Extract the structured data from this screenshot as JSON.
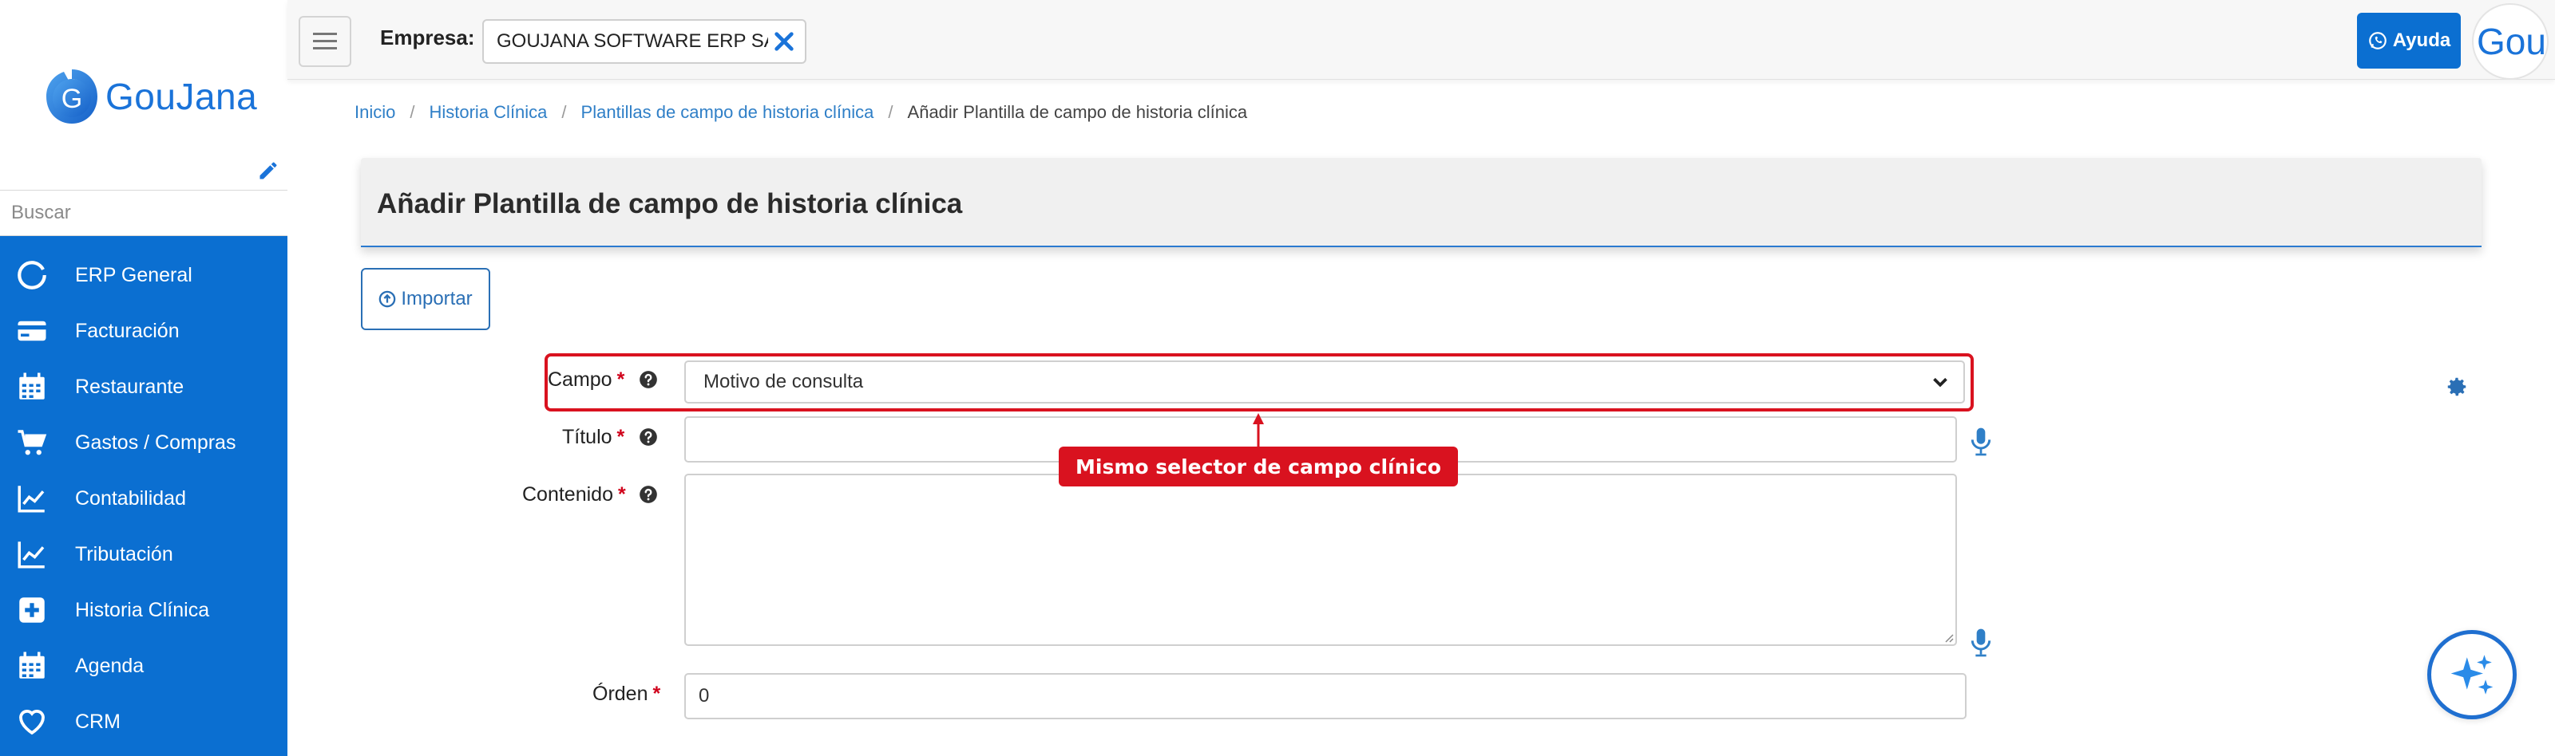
{
  "sidebar": {
    "logo_text": "GouJana",
    "search_placeholder": "Buscar",
    "items": [
      {
        "label": "ERP General",
        "icon": "refresh-circle-icon"
      },
      {
        "label": "Facturación",
        "icon": "credit-card-icon"
      },
      {
        "label": "Restaurante",
        "icon": "calendar-icon"
      },
      {
        "label": "Gastos / Compras",
        "icon": "cart-icon"
      },
      {
        "label": "Contabilidad",
        "icon": "chart-line-icon"
      },
      {
        "label": "Tributación",
        "icon": "chart-line-icon"
      },
      {
        "label": "Historia Clínica",
        "icon": "plus-square-icon"
      },
      {
        "label": "Agenda",
        "icon": "calendar-icon"
      },
      {
        "label": "CRM",
        "icon": "heart-icon"
      }
    ]
  },
  "topbar": {
    "empresa_label": "Empresa:",
    "empresa_value": "GOUJANA SOFTWARE ERP SAS",
    "help_label": "Ayuda",
    "avatar_text": "Gou"
  },
  "breadcrumb": {
    "items": [
      "Inicio",
      "Historia Clínica",
      "Plantillas de campo de historia clínica"
    ],
    "current": "Añadir Plantilla de campo de historia clínica"
  },
  "page": {
    "title": "Añadir Plantilla de campo de historia clínica",
    "import_label": "Importar"
  },
  "form": {
    "campo": {
      "label": "Campo",
      "required": "*",
      "value": "Motivo de consulta"
    },
    "titulo": {
      "label": "Título",
      "required": "*",
      "value": ""
    },
    "contenido": {
      "label": "Contenido",
      "required": "*",
      "value": ""
    },
    "orden": {
      "label": "Órden",
      "required": "*",
      "value": "0"
    }
  },
  "annotation": {
    "callout_text": "Mismo selector de campo clínico",
    "color": "#d9121f"
  },
  "colors": {
    "sidebar": "#0b6fd1",
    "accent": "#2a7ad0",
    "required": "#d0021b"
  }
}
